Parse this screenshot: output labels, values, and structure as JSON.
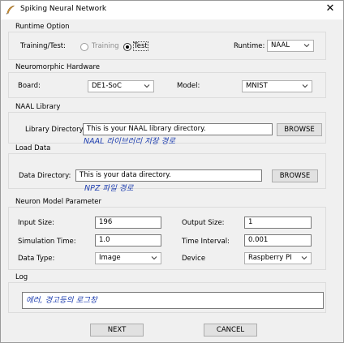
{
  "window": {
    "title": "Spiking Neural Network",
    "close_glyph": "✕"
  },
  "runtime_option": {
    "group_label": "Runtime Option",
    "mode_label": "Training/Test:",
    "training_label": "Training",
    "test_label": "Test",
    "selected": "Test",
    "runtime_label": "Runtime:",
    "runtime_value": "NAAL"
  },
  "hardware": {
    "group_label": "Neuromorphic Hardware",
    "board_label": "Board:",
    "board_value": "DE1-SoC",
    "model_label": "Model:",
    "model_value": "MNIST"
  },
  "naal": {
    "group_label": "NAAL Library",
    "dir_label": "Library Directory:",
    "dir_value": "This is your NAAL library directory.",
    "browse_label": "BROWSE",
    "note": "NAAL  라이브러리 저장 경로"
  },
  "load_data": {
    "group_label": "Load Data",
    "dir_label": "Data Directory:",
    "dir_value": "This is your data directory.",
    "browse_label": "BROWSE",
    "note": "NPZ 파일 경로"
  },
  "neuron": {
    "group_label": "Neuron Model Parameter",
    "input_size_label": "Input Size:",
    "input_size_value": "196",
    "output_size_label": "Output Size:",
    "output_size_value": "1",
    "sim_time_label": "Simulation Time:",
    "sim_time_value": "1.0",
    "time_interval_label": "Time Interval:",
    "time_interval_value": "0.001",
    "data_type_label": "Data Type:",
    "data_type_value": "Image",
    "device_label": "Device",
    "device_value": "Raspberry PI"
  },
  "log": {
    "group_label": "Log",
    "note": "에러, 경고등의 로그창"
  },
  "footer": {
    "next_label": "NEXT",
    "cancel_label": "CANCEL"
  },
  "colors": {
    "note_blue": "#1f3fb0",
    "window_bg": "#f0f0f0",
    "button_bg": "#e1e1e1"
  },
  "icons": {
    "app": "feather-app-icon",
    "dropdown": "chevron-down-icon",
    "close": "close-icon"
  }
}
